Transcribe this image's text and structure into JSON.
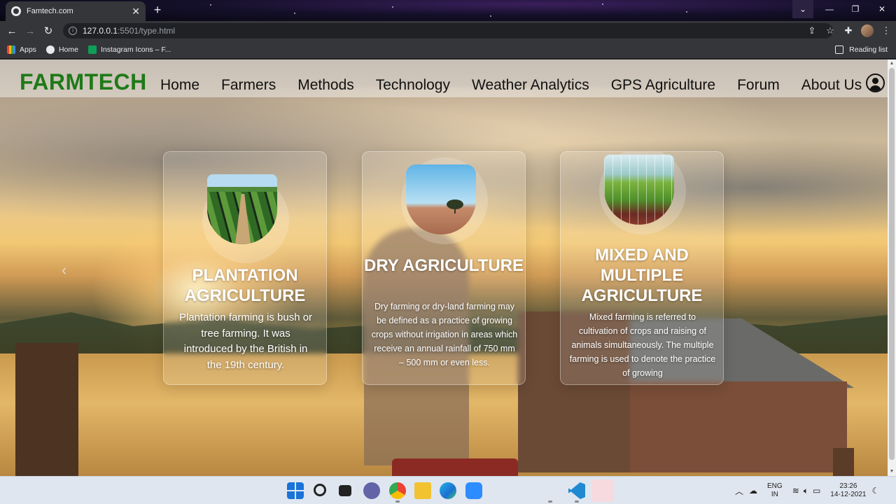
{
  "browser": {
    "tab_title": "Famtech.com",
    "tab_close": "✕",
    "new_tab": "+",
    "url_host": "127.0.0.1",
    "url_rest": ":5501/type.html",
    "window_controls": [
      "⌄",
      "—",
      "❐",
      "✕"
    ],
    "bookmarks": [
      "Apps",
      "Home",
      "Instagram Icons – F..."
    ],
    "reading_list": "Reading list"
  },
  "site": {
    "logo": "FARMTECH",
    "nav": [
      "Home",
      "Farmers",
      "Methods",
      "Technology",
      "Weather Analytics",
      "GPS Agriculture",
      "Forum",
      "About Us"
    ],
    "prev_arrow": "‹"
  },
  "cards": [
    {
      "title": "PLANTATION AGRICULTURE",
      "text": "Plantation farming is bush or tree farming. It was introduced by the British in the 19th century."
    },
    {
      "title": "DRY AGRICULTURE",
      "text": "Dry farming or dry-land farming may be defined as a practice of growing crops without irrigation in areas which receive an annual rainfall of 750 mm – 500 mm or even less."
    },
    {
      "title": "MIXED AND MULTIPLE AGRICULTURE",
      "text": "Mixed farming is referred to cultivation of crops and raising of animals simultaneously. The multiple farming is used to denote the practice of growing"
    }
  ],
  "taskbar": {
    "language_top": "ENG",
    "language_bottom": "IN",
    "time": "23:26",
    "date": "14-12-2021",
    "tray_chevron": "︿"
  },
  "colors": {
    "logo": "#1e7a18",
    "chrome_bg": "#35363a",
    "taskbar_bg": "#dfe6ef"
  }
}
